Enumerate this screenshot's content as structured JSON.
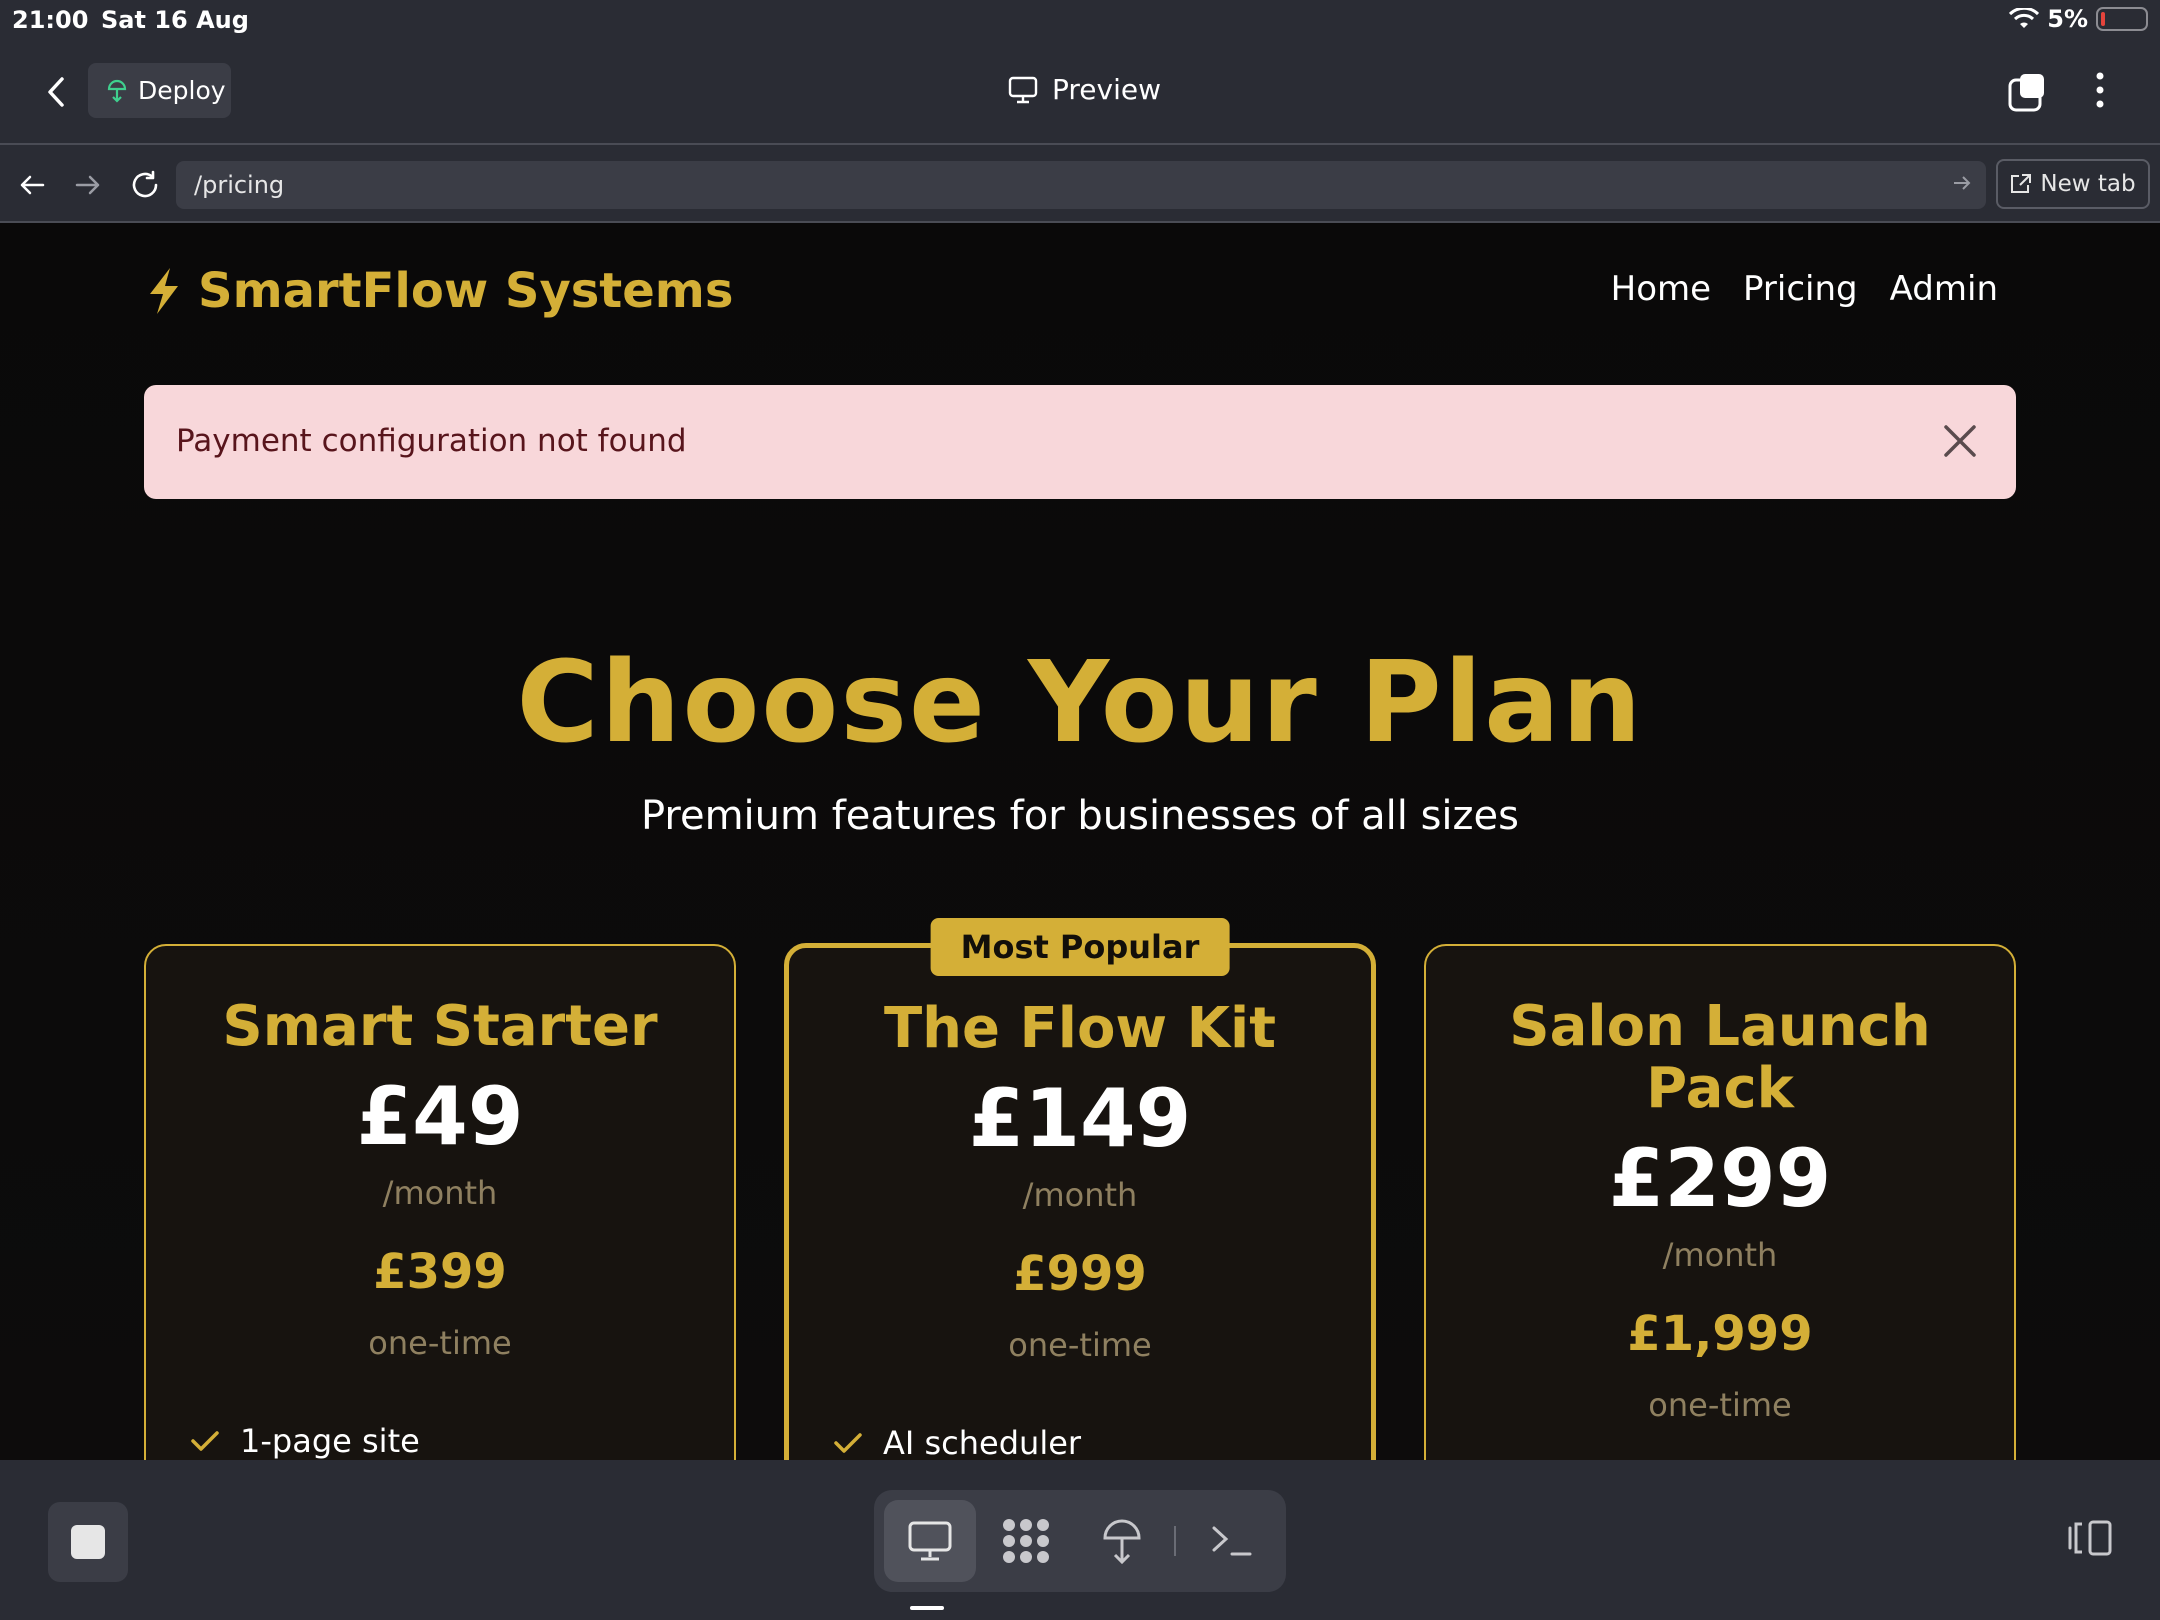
{
  "status": {
    "time": "21:00",
    "date": "Sat 16 Aug",
    "battery": "5%"
  },
  "header": {
    "deploy_label": "Deploy",
    "title": "Preview"
  },
  "urlbar": {
    "url": "/pricing",
    "new_tab_label": "New tab"
  },
  "site": {
    "brand": "SmartFlow Systems",
    "nav": [
      "Home",
      "Pricing",
      "Admin"
    ]
  },
  "alert": {
    "message": "Payment configuration not found"
  },
  "hero": {
    "title": "Choose Your Plan",
    "subtitle": "Premium features for businesses of all sizes"
  },
  "plans": [
    {
      "name": "Smart Starter",
      "price": "£49",
      "per": "/month",
      "onetime_price": "£399",
      "onetime_label": "one-time",
      "feature": "1-page site"
    },
    {
      "badge": "Most Popular",
      "name": "The Flow Kit",
      "price": "£149",
      "per": "/month",
      "onetime_price": "£999",
      "onetime_label": "one-time",
      "feature": "AI scheduler"
    },
    {
      "name": "Salon Launch Pack",
      "price": "£299",
      "per": "/month",
      "onetime_price": "£1,999",
      "onetime_label": "one-time"
    }
  ],
  "colors": {
    "accent": "#d4af37",
    "alert_bg": "#f8d7da",
    "alert_text": "#58151c",
    "chrome": "#2a2c34"
  },
  "icons": [
    "chevron-left-icon",
    "deploy-icon",
    "monitor-icon",
    "tabs-icon",
    "more-vertical-icon",
    "arrow-left-icon",
    "arrow-right-icon",
    "reload-icon",
    "external-link-icon",
    "lightning-icon",
    "close-icon",
    "check-icon",
    "stop-icon",
    "grid-icon",
    "terminal-icon",
    "split-view-icon"
  ]
}
